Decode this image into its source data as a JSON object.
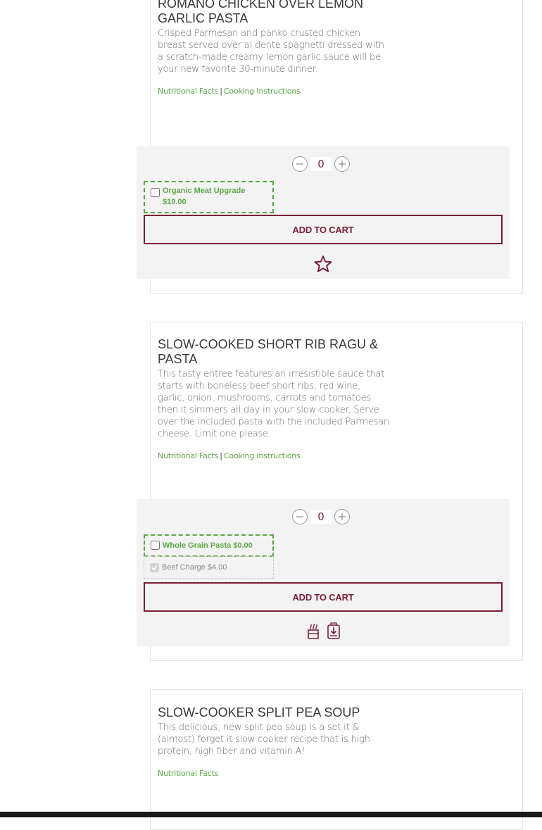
{
  "products": [
    {
      "title": "ROMANO CHICKEN OVER LEMON GARLIC PASTA",
      "description": "Crisped Parmesan and panko crusted chicken breast served over al dente spaghetti dressed with a scratch-made creamy lemon garlic sauce will be your new favorite 30-minute dinner.",
      "nutrition_link": "Nutritional Facts",
      "separator": "|",
      "cooking_link": "Cooking Instructions",
      "quantity": "0",
      "option_label": "Organic Meat Upgrade $10.00",
      "add_to_cart": "ADD TO CART",
      "icons": [
        "star-outline-icon"
      ]
    },
    {
      "title": "SLOW-COOKED SHORT RIB RAGU & PASTA",
      "description": "This tasty entree features an irresistible sauce that starts with boneless beef short ribs, red wine, garlic, onion, mushrooms, carrots and tomatoes then it simmers all day in your slow-cooker. Serve over the included pasta with the included Parmesan cheese. Limit one please.",
      "nutrition_link": "Nutritional Facts",
      "separator": "|",
      "cooking_link": "Cooking Instructions",
      "quantity": "0",
      "option_label": "Whole Grain Pasta $0.00",
      "disabled_option_label": "Beef Charge $4.00",
      "add_to_cart": "ADD TO CART",
      "icons": [
        "thaw-icon",
        "slow-cooker-icon"
      ]
    },
    {
      "title": "SLOW-COOKER SPLIT PEA SOUP",
      "description": "This delicious, new split pea soup is a set it & (almost) forget it slow cooker recipe that is high protein, high fiber and vitamin A!",
      "nutrition_link": "Nutritional Facts"
    }
  ],
  "colors": {
    "brand_maroon": "#7a1e35",
    "link_green": "#5aa845",
    "panel_gray": "#f3f3f3"
  }
}
